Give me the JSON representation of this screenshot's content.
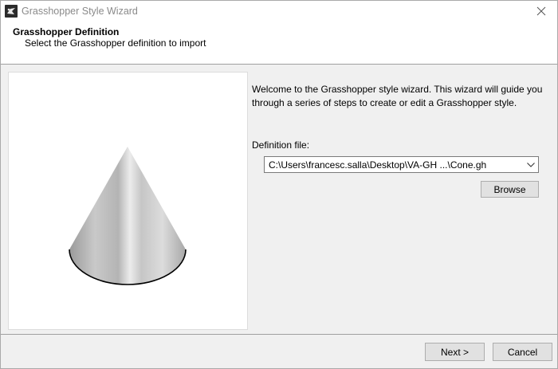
{
  "window": {
    "title": "Grasshopper Style Wizard",
    "icons": {
      "app": "grasshopper-app-icon",
      "close": "close-icon"
    }
  },
  "header": {
    "title": "Grasshopper Definition",
    "subtitle": "Select the Grasshopper definition to import"
  },
  "preview": {
    "image": "cone-3d-preview"
  },
  "main": {
    "welcome_text": "Welcome to the Grasshopper style wizard. This wizard will guide you through a series of steps to create or edit a Grasshopper style.",
    "definition_label": "Definition file:",
    "definition_value": "C:\\Users\\francesc.salla\\Desktop\\VA-GH ...\\Cone.gh",
    "browse_label": "Browse"
  },
  "footer": {
    "next_label": "Next >",
    "cancel_label": "Cancel"
  }
}
